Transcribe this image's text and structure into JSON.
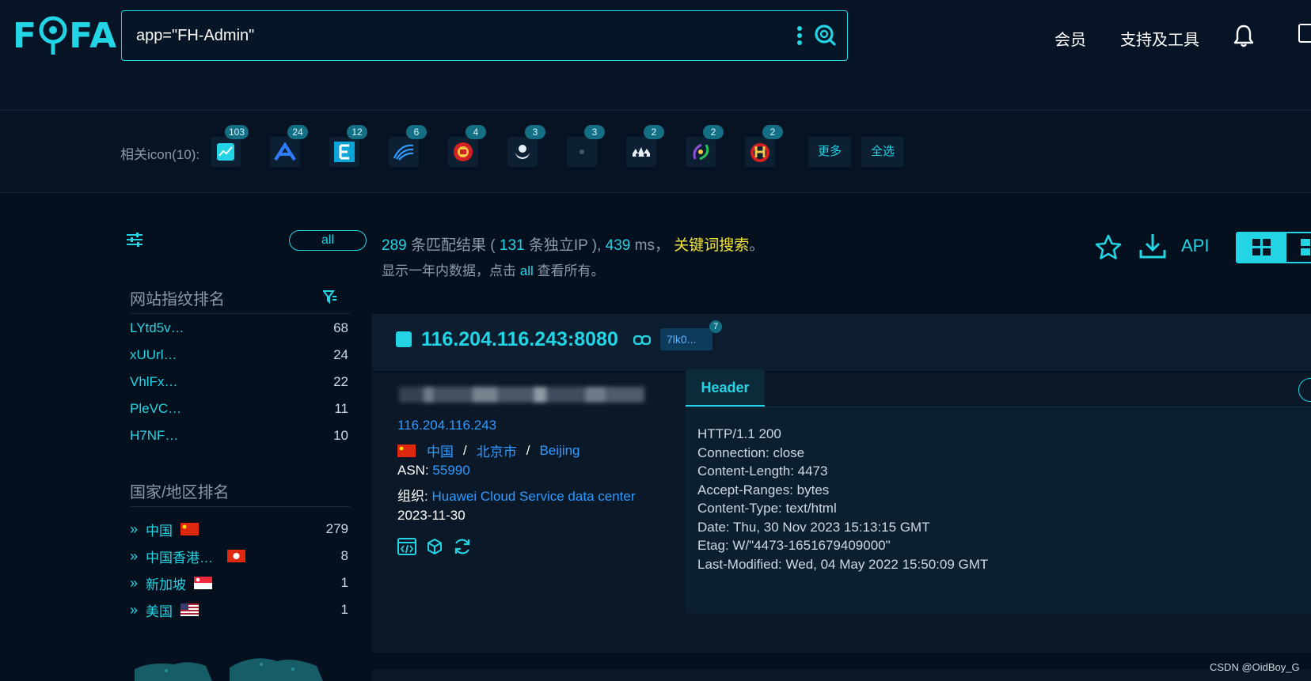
{
  "brand": {
    "name": "FOFA"
  },
  "search": {
    "query": "app=\"FH-Admin\""
  },
  "nav": {
    "member": "会员",
    "tools": "支持及工具"
  },
  "related_icons": {
    "label": "相关icon(10):",
    "items": [
      {
        "count": "103"
      },
      {
        "count": "24"
      },
      {
        "count": "12"
      },
      {
        "count": "6"
      },
      {
        "count": "4"
      },
      {
        "count": "3"
      },
      {
        "count": "3"
      },
      {
        "count": "2"
      },
      {
        "count": "2"
      },
      {
        "count": "2"
      }
    ],
    "more": "更多",
    "select_all": "全选"
  },
  "sidebar": {
    "all_label": "all",
    "fingerprint_title": "网站指纹排名",
    "fingerprints": [
      {
        "name": "LYtd5v…",
        "count": "68"
      },
      {
        "name": "xUUrl…",
        "count": "24"
      },
      {
        "name": "VhlFx…",
        "count": "22"
      },
      {
        "name": "PleVC…",
        "count": "11"
      },
      {
        "name": "H7NF…",
        "count": "10"
      }
    ],
    "country_title": "国家/地区排名",
    "countries": [
      {
        "name": "中国",
        "count": "279",
        "flag": "cn"
      },
      {
        "name": "中国香港…",
        "count": "8",
        "flag": "hk"
      },
      {
        "name": "新加坡",
        "count": "1",
        "flag": "sg"
      },
      {
        "name": "美国",
        "count": "1",
        "flag": "us"
      }
    ]
  },
  "summary": {
    "total": "289",
    "t1": "条匹配结果 (",
    "ips": "131",
    "t2": "条独立IP ),",
    "ms": "439",
    "t3": "ms，",
    "keyword": "关键词搜索",
    "t4": "。",
    "line2_a": "显示一年内数据，点击",
    "line2_link": "all",
    "line2_b": "查看所有。"
  },
  "toolbar": {
    "api": "API"
  },
  "result": {
    "host": "116.204.116.243:8080",
    "tag": "7lk0...",
    "tag_count": "7",
    "ip": "116.204.116.243",
    "country": "中国",
    "province": "北京市",
    "city": "Beijing",
    "asn_label": "ASN:",
    "asn": "55990",
    "org_label": "组织:",
    "org": "Huawei Cloud Service data center",
    "date": "2023-11-30",
    "tab": "Header",
    "header_lines": [
      "HTTP/1.1 200",
      "Connection: close",
      "Content-Length: 4473",
      "Accept-Ranges: bytes",
      "Content-Type: text/html",
      "Date: Thu, 30 Nov 2023 15:13:15 GMT",
      "Etag: W/\"4473-1651679409000\"",
      "Last-Modified: Wed, 04 May 2022 15:50:09 GMT"
    ]
  },
  "watermark": "CSDN @OidBoy_G",
  "colors": {
    "accent": "#23d4e4",
    "link": "#2f9bff",
    "keyword": "#f4e43a",
    "background": "#04101e"
  }
}
